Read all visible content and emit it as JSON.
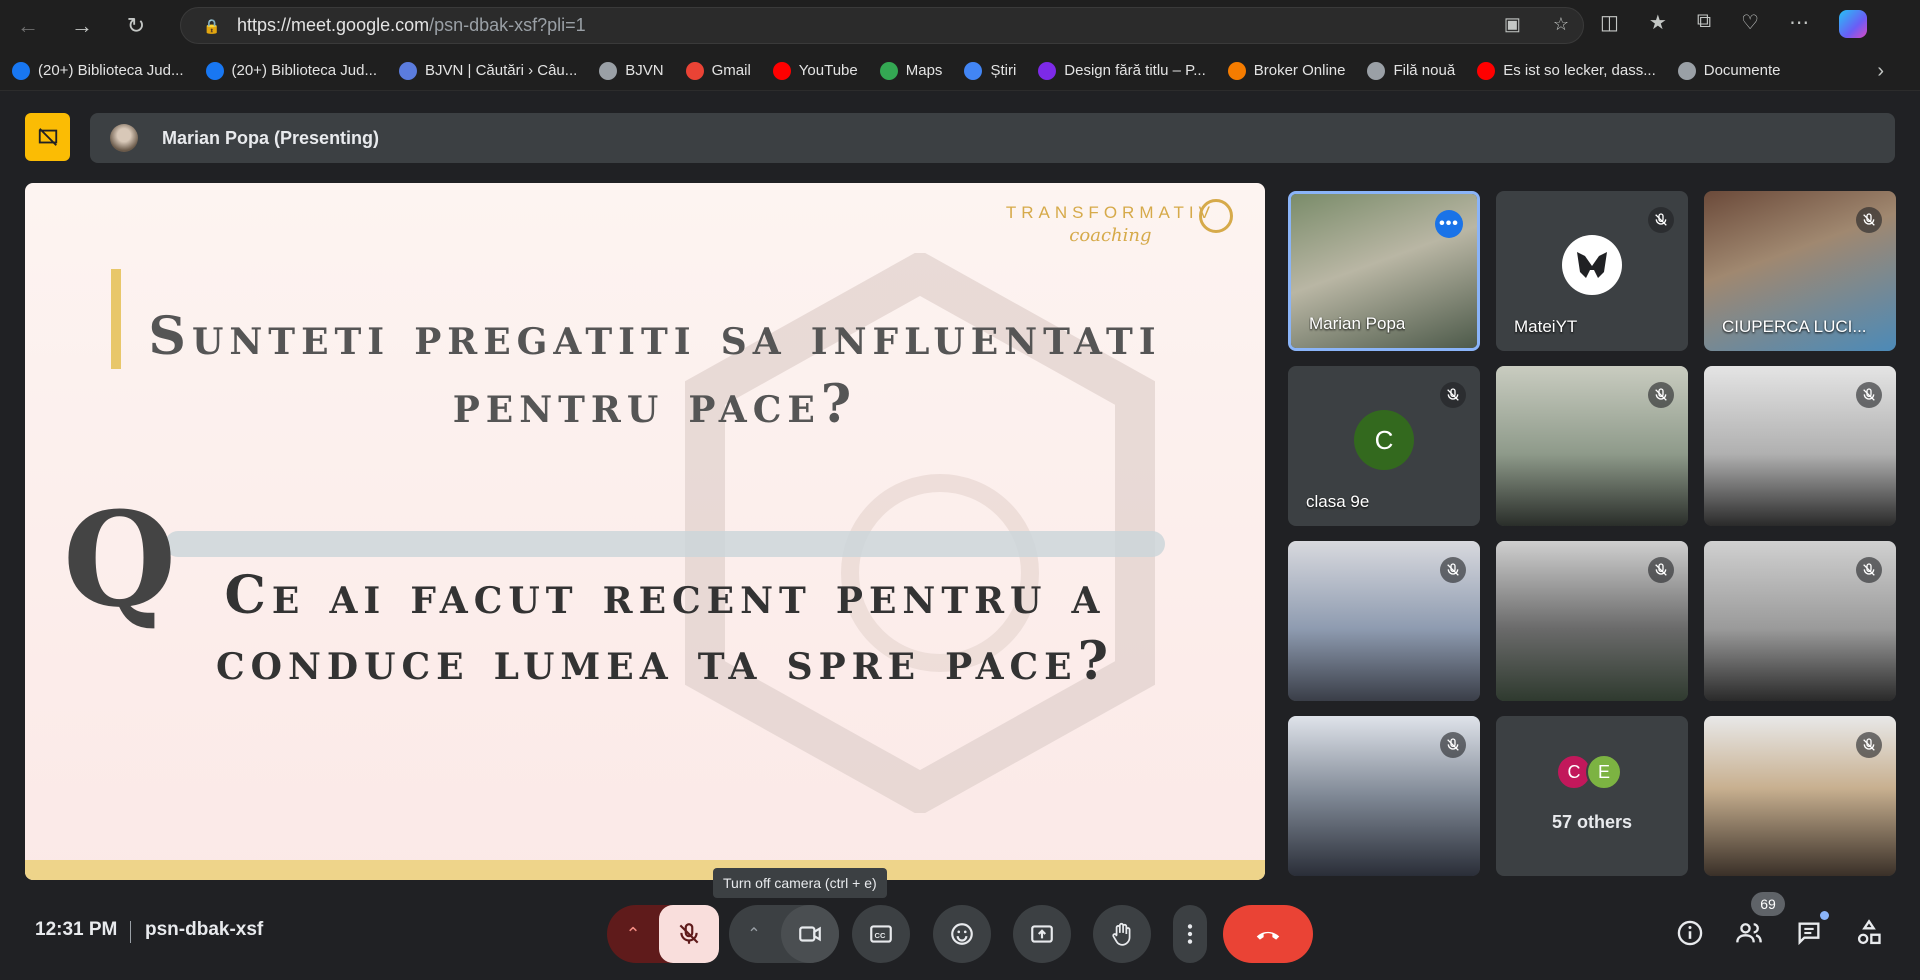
{
  "browser": {
    "url_host": "https://meet.google.com",
    "url_path": "/psn-dbak-xsf?pli=1",
    "bookmarks": [
      {
        "label": "(20+) Biblioteca Jud...",
        "icon": "facebook-icon",
        "color": "#1877f2"
      },
      {
        "label": "(20+) Biblioteca Jud...",
        "icon": "facebook-icon",
        "color": "#1877f2"
      },
      {
        "label": "BJVN | Căutări › Câu...",
        "icon": "search-icon",
        "color": "#5b7cde"
      },
      {
        "label": "BJVN",
        "icon": "page-icon",
        "color": "#9aa0a6"
      },
      {
        "label": "Gmail",
        "icon": "gmail-icon",
        "color": "#ea4335"
      },
      {
        "label": "YouTube",
        "icon": "youtube-icon",
        "color": "#ff0000"
      },
      {
        "label": "Maps",
        "icon": "maps-icon",
        "color": "#34a853"
      },
      {
        "label": "Știri",
        "icon": "news-icon",
        "color": "#4285f4"
      },
      {
        "label": "Design fără titlu – P...",
        "icon": "canva-icon",
        "color": "#7d2ae8"
      },
      {
        "label": "Broker Online",
        "icon": "broker-icon",
        "color": "#f57c00"
      },
      {
        "label": "Filă nouă",
        "icon": "page-icon",
        "color": "#9aa0a6"
      },
      {
        "label": "Es ist so lecker, dass...",
        "icon": "youtube-icon",
        "color": "#ff0000"
      },
      {
        "label": "Documente",
        "icon": "page-icon",
        "color": "#9aa0a6"
      }
    ]
  },
  "meet": {
    "presenter_label": "Marian Popa (Presenting)",
    "slide": {
      "logo_text": "TRANSFORMATIV",
      "logo_sub": "coaching",
      "question_top": "Sunteti pregatiti sa influentati pentru pace?",
      "big_letter": "Q",
      "question_bottom": "Ce ai facut recent pentru a conduce lumea ta spre pace?"
    },
    "tiles": [
      {
        "name": "Marian Popa",
        "type": "video",
        "active": true
      },
      {
        "name": "MateiYT",
        "type": "avatar"
      },
      {
        "name": "CIUPERCA LUCI...",
        "type": "video"
      },
      {
        "name": "clasa 9e",
        "type": "avatar",
        "initial": "C"
      },
      {
        "name": "",
        "type": "video"
      },
      {
        "name": "",
        "type": "video"
      },
      {
        "name": "",
        "type": "video"
      },
      {
        "name": "",
        "type": "video"
      },
      {
        "name": "",
        "type": "video"
      },
      {
        "name": "",
        "type": "video"
      },
      {
        "name": "57 others",
        "type": "others"
      },
      {
        "name": "",
        "type": "video"
      }
    ],
    "others": {
      "initial_1": "C",
      "initial_2": "E",
      "label": "57 others"
    },
    "time": "12:31 PM",
    "meeting_code": "psn-dbak-xsf",
    "tooltip": "Turn off camera (ctrl + e)",
    "participant_count": "69"
  },
  "colors": {
    "accent": "#8ab4f8",
    "end_call": "#ea4335",
    "present_stop": "#fbbc04",
    "mic_muted_bg": "#f9dedc"
  }
}
